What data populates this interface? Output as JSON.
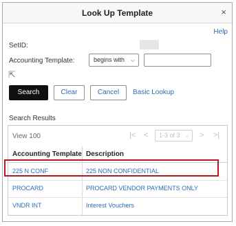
{
  "dialog": {
    "title": "Look Up Template",
    "close_glyph": "×",
    "help_label": "Help"
  },
  "form": {
    "setid_label": "SetID:",
    "setid_value": "",
    "template_label": "Accounting Template:",
    "operator_selected": "begins with",
    "template_value": ""
  },
  "buttons": {
    "search": "Search",
    "clear": "Clear",
    "cancel": "Cancel",
    "basic_lookup": "Basic Lookup"
  },
  "results": {
    "title": "Search Results",
    "view_label": "View 100",
    "page_indicator": "1-3 of 3",
    "columns": [
      "Accounting Template",
      "Description"
    ],
    "rows": [
      {
        "template": "225 N CONF",
        "description": "225 NON CONFIDENTIAL",
        "highlighted": true
      },
      {
        "template": "PROCARD",
        "description": "PROCARD VENDOR PAYMENTS ONLY",
        "highlighted": false
      },
      {
        "template": "VNDR INT",
        "description": "Interest Vouchers",
        "highlighted": false
      }
    ]
  },
  "colors": {
    "link": "#2b6cb0",
    "primary_button": "#111111",
    "highlight_box": "#b5171f"
  },
  "icons": {
    "close": "close-icon",
    "dropdown": "chevron-down-icon",
    "first": "first-page-icon",
    "prev": "prev-page-icon",
    "next": "next-page-icon",
    "last": "last-page-icon",
    "cursor": "mouse-pointer-icon"
  }
}
